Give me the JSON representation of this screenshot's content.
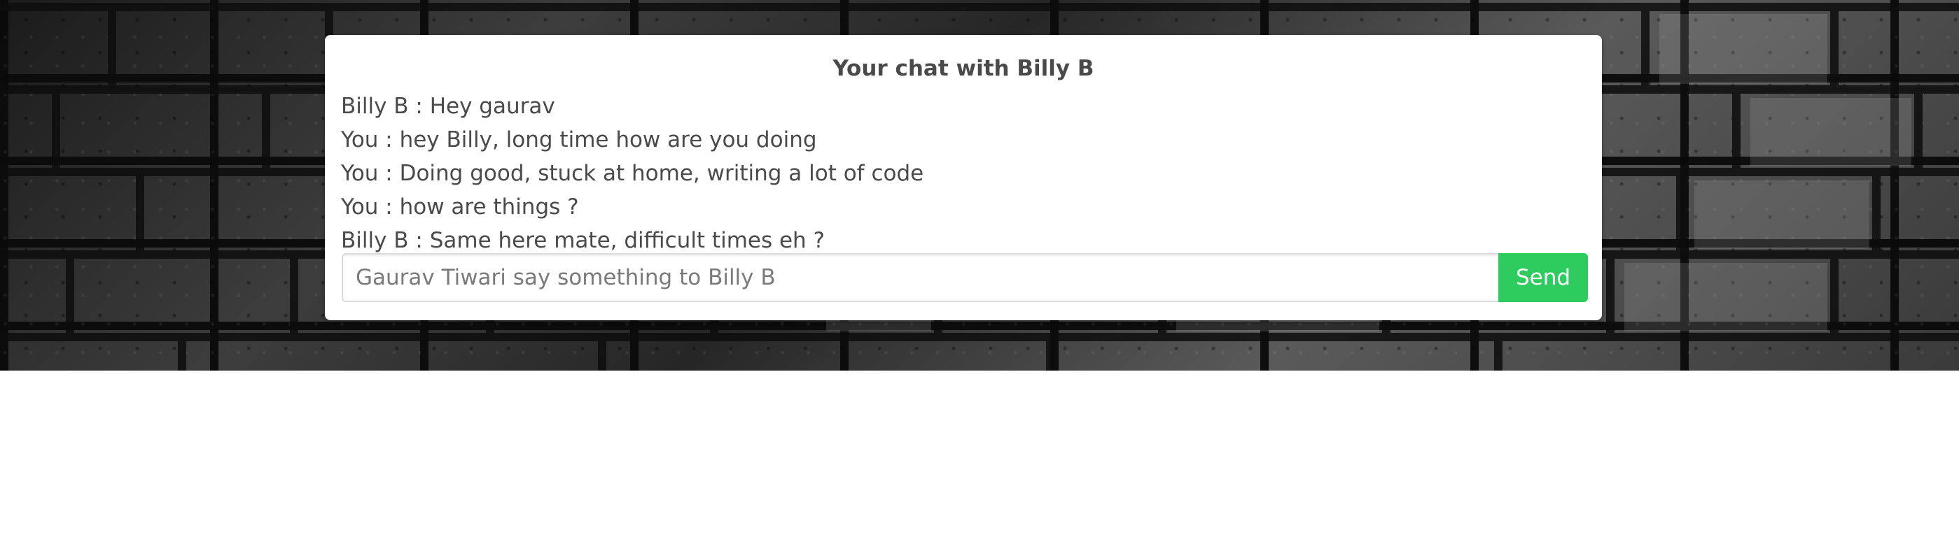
{
  "chat": {
    "title": "Your chat with Billy B",
    "messages": [
      {
        "text": "Billy B : Hey gaurav"
      },
      {
        "text": "You : hey Billy, long time how are you doing"
      },
      {
        "text": "You : Doing good, stuck at home, writing a lot of code"
      },
      {
        "text": "You : how are things ?"
      },
      {
        "text": "Billy B : Same here mate, difficult times eh ?"
      }
    ],
    "input": {
      "value": "",
      "placeholder": "Gaurav Tiwari say something to Billy B"
    },
    "send_label": "Send"
  },
  "colors": {
    "send_button": "#2ecc5f",
    "text": "#4a4a4a",
    "background_hero": "#2a2a2a"
  }
}
